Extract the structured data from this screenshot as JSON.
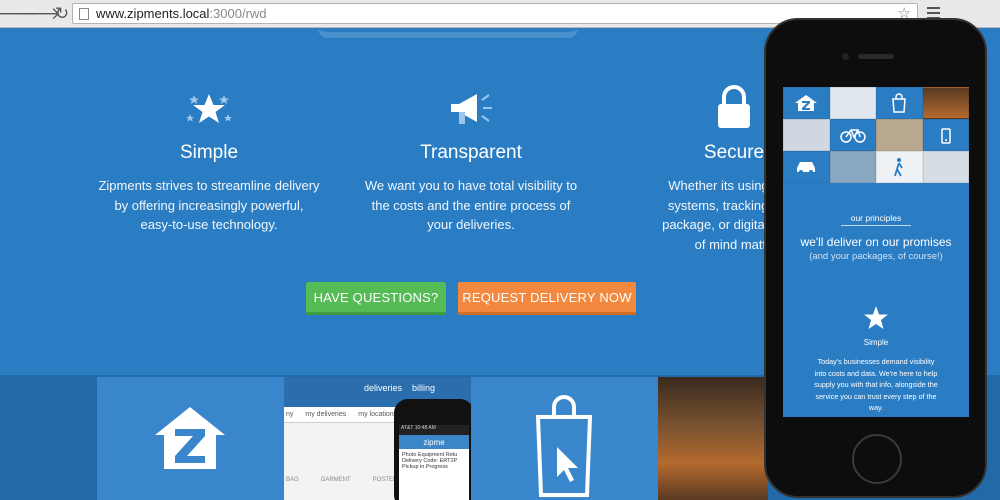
{
  "browser": {
    "url_host": "www.zipments.local",
    "url_path": ":3000/rwd",
    "back_glyph": "🡐",
    "forward_glyph": "🡒",
    "reload_glyph": "↻",
    "star_glyph": "☆"
  },
  "features": [
    {
      "icon": "stars-icon",
      "title": "Simple",
      "lines": [
        "Zipments strives to streamline delivery",
        "by offering increasingly powerful,",
        "easy-to-use technology."
      ]
    },
    {
      "icon": "megaphone-icon",
      "title": "Transparent",
      "lines": [
        "We want you to have total visibility to",
        "the costs and the entire process of",
        "your deliveries."
      ]
    },
    {
      "icon": "lock-icon",
      "title": "Secure",
      "lines": [
        "Whether its using secu",
        "systems, tracking of yo",
        "package, or digital signat",
        "of mind matte"
      ]
    }
  ],
  "buttons": {
    "questions": "HAVE QUESTIONS?",
    "request": "REQUEST DELIVERY NOW"
  },
  "screenshot_tile": {
    "tabs": [
      "deliveries",
      "billing"
    ],
    "nav": [
      "ny",
      "my deliveries",
      "my locations"
    ],
    "items": [
      "BAG",
      "GARMENT",
      "POSTER"
    ],
    "mini_status": "AT&T  10:48 AM",
    "mini_brand": "zipme",
    "mini_lines": [
      "Photo Equipment Retu",
      "Delivery Code: ERT2P",
      "Pickup in Progress"
    ]
  },
  "phone": {
    "principles": "our principles",
    "promise": "we'll deliver on our promises",
    "packages": "(and your packages, of course!)",
    "simple_title": "Simple",
    "simple_lines": [
      "Today's businesses demand visibility",
      "into costs and data. We're here to help",
      "supply you with that info, alongside the",
      "service you can trust every step of the",
      "way."
    ]
  },
  "colors": {
    "page_blue": "#2b7dc3",
    "green": "#55bb55",
    "orange": "#f2893e"
  }
}
